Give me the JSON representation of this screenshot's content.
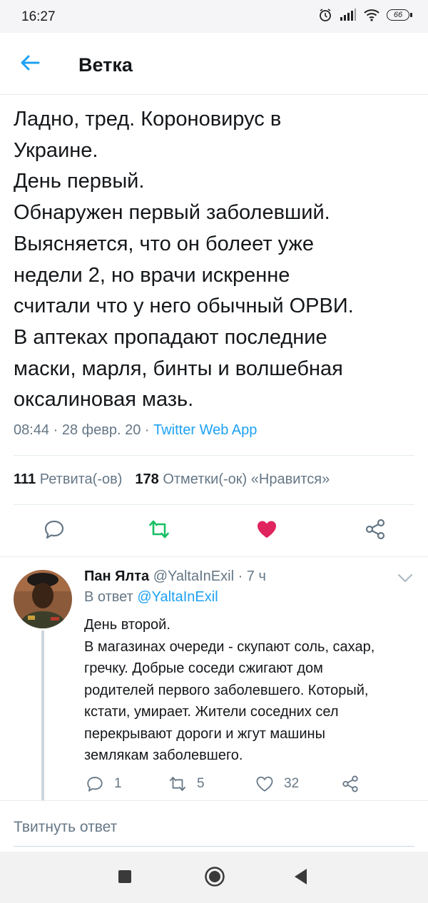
{
  "status_bar": {
    "time": "16:27",
    "battery": "66"
  },
  "header": {
    "title": "Ветка"
  },
  "tweet": {
    "text": "Ладно, тред. Короновирус в\nУкраине.\nДень первый.\nОбнаружен первый заболевший.\nВыясняется, что он болеет уже\nнедели 2, но врачи искренне\nсчитали что у него обычный ОРВИ.\nВ аптеках пропадают последние\nмаски, марля, бинты и волшебная\nоксалиновая мазь.",
    "time": "08:44",
    "date": "28 февр. 20",
    "source": "Twitter Web App",
    "retweets_count": "111",
    "retweets_label": "Ретвита(-ов)",
    "likes_count": "178",
    "likes_label": "Отметки(-ок) «Нравится»"
  },
  "reply": {
    "author_name": "Пан Ялта",
    "handle": "@YaltaInExil",
    "age": "7 ч",
    "reply_to_label": "В ответ",
    "reply_to_handle": "@YaltaInExil",
    "text": "День второй.\nВ магазинах очереди - скупают соль, сахар,\nгречку. Добрые соседи сжигают дом\nродителей первого заболевшего. Который,\nкстати, умирает. Жители соседних сел\nперекрывают дороги и жгут машины\nземлякам заболевшего.",
    "replies": "1",
    "retweets": "5",
    "likes": "32"
  },
  "compose": {
    "placeholder": "Твитнуть ответ"
  },
  "colors": {
    "accent": "#1da1f2",
    "retweet_green": "#17bf63",
    "like_red": "#e0245e",
    "muted": "#657786"
  },
  "icons": [
    "back-arrow-icon",
    "reply-icon",
    "retweet-icon",
    "heart-icon",
    "share-icon",
    "chevron-down-icon",
    "alarm-icon",
    "signal-icon",
    "wifi-icon"
  ]
}
